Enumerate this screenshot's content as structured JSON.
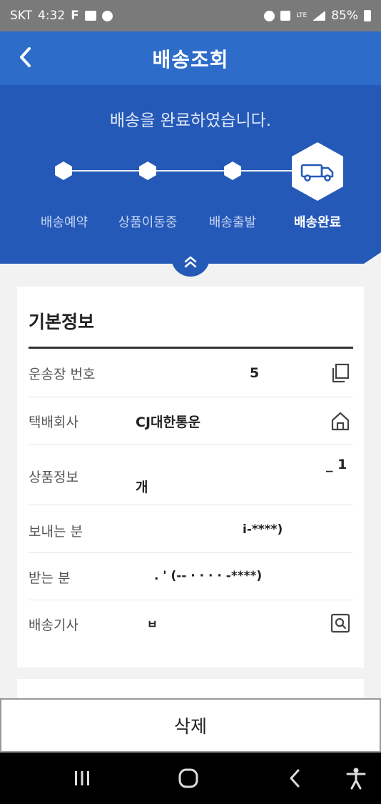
{
  "status_bar": {
    "carrier": "SKT",
    "time": "4:32",
    "f_icon": "F",
    "battery": "85%",
    "network": "LTE"
  },
  "app_bar": {
    "title": "배송조회",
    "back_icon": "chevron-left-icon"
  },
  "progress": {
    "message": "배송을 완료하였습니다.",
    "steps": [
      {
        "label": "배송예약",
        "state": "done"
      },
      {
        "label": "상품이동중",
        "state": "done"
      },
      {
        "label": "배송출발",
        "state": "done"
      },
      {
        "label": "배송완료",
        "state": "current"
      }
    ],
    "collapse_icon": "double-chevron-up-icon"
  },
  "basic_info": {
    "title": "기본정보",
    "rows": [
      {
        "label": "운송장 번호",
        "value": "5",
        "action_icon": "copy-icon"
      },
      {
        "label": "택배회사",
        "value": "CJ대한통운",
        "action_icon": "home-icon"
      },
      {
        "label": "상품정보",
        "value_top": "_ 1",
        "value": "개"
      },
      {
        "label": "보내는 분",
        "value": "i-****)"
      },
      {
        "label": "받는 분",
        "value": ". ' (-- · · · · -****)"
      },
      {
        "label": "배송기사",
        "value": "ㅂ",
        "action_icon": "search-doc-icon"
      }
    ]
  },
  "delete_button": {
    "label": "삭제"
  },
  "colors": {
    "appbar": "#2e6cc9",
    "header": "#2559b8",
    "background": "#f2f2f2"
  }
}
